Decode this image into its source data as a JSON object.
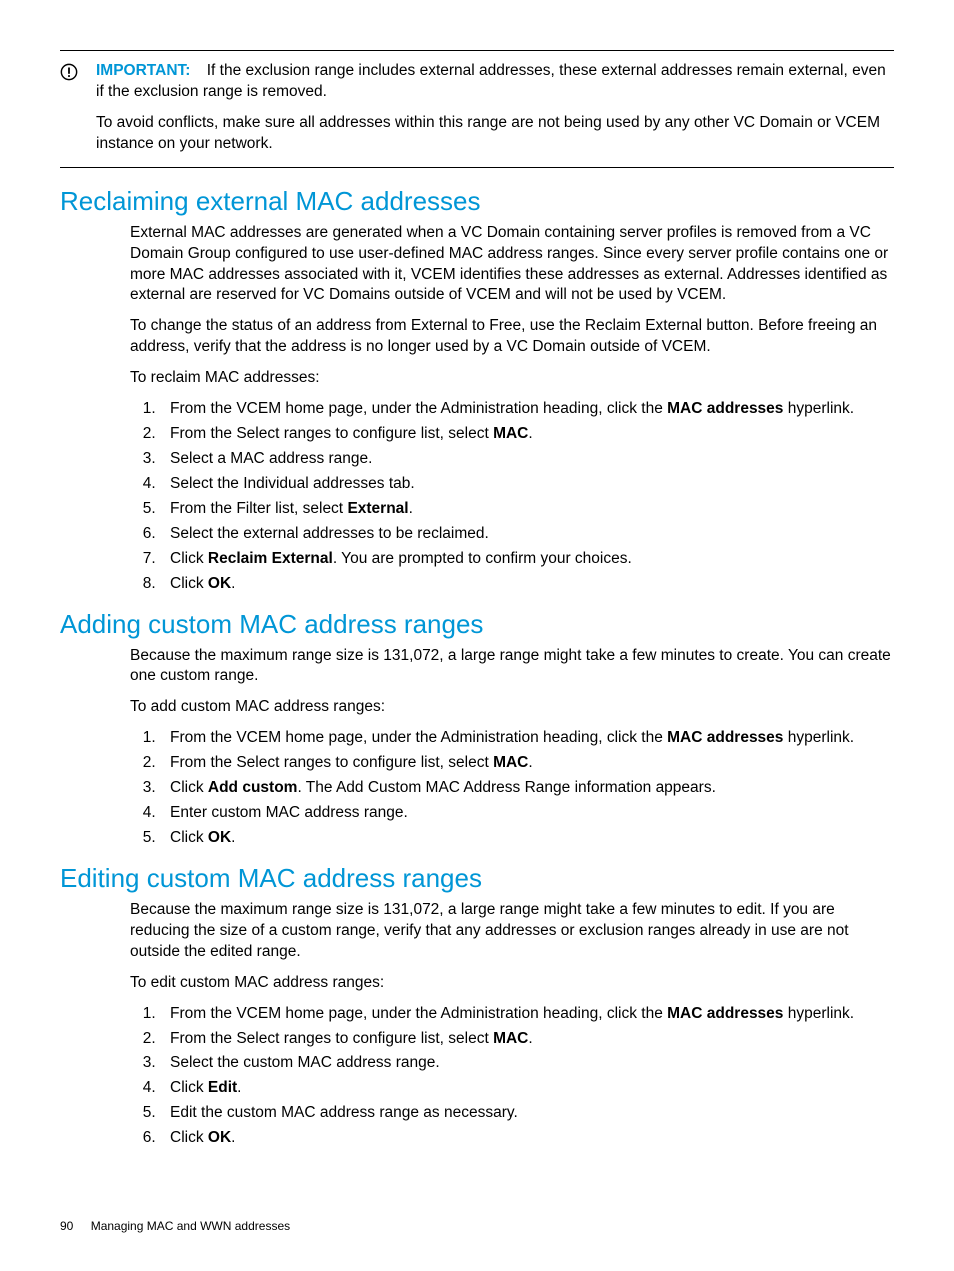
{
  "callout": {
    "label": "IMPORTANT:",
    "p1_a": "If the exclusion range includes external addresses, these external addresses remain external, even if the exclusion range is removed.",
    "p2": "To avoid conflicts, make sure all addresses within this range are not being used by any other VC Domain or VCEM instance on your network."
  },
  "s1": {
    "heading": "Reclaiming external MAC addresses",
    "p1": "External MAC addresses are generated when a VC Domain containing server profiles is removed from a VC Domain Group configured to use user-defined MAC address ranges. Since every server profile contains one or more MAC addresses associated with it, VCEM identifies these addresses as external. Addresses identified as external are reserved for VC Domains outside of VCEM and will not be used by VCEM.",
    "p2": "To change the status of an address from External to Free, use the Reclaim External button. Before freeing an address, verify that the address is no longer used by a VC Domain outside of VCEM.",
    "p3": "To reclaim MAC addresses:",
    "steps": {
      "s1a": "From the VCEM home page, under the Administration heading, click the ",
      "s1b": "MAC addresses",
      "s1c": " hyperlink.",
      "s2a": "From the Select ranges to configure list, select ",
      "s2b": "MAC",
      "s2c": ".",
      "s3": "Select a MAC address range.",
      "s4": "Select the Individual addresses tab.",
      "s5a": "From the Filter list, select ",
      "s5b": "External",
      "s5c": ".",
      "s6": "Select the external addresses to be reclaimed.",
      "s7a": "Click ",
      "s7b": "Reclaim External",
      "s7c": ". You are prompted to confirm your choices.",
      "s8a": "Click ",
      "s8b": "OK",
      "s8c": "."
    }
  },
  "s2": {
    "heading": "Adding custom MAC address ranges",
    "p1": "Because the maximum range size is 131,072, a large range might take a few minutes to create. You can create one custom range.",
    "p2": "To add custom MAC address ranges:",
    "steps": {
      "s1a": "From the VCEM home page, under the Administration heading, click the ",
      "s1b": "MAC addresses",
      "s1c": " hyperlink.",
      "s2a": "From the Select ranges to configure list, select ",
      "s2b": "MAC",
      "s2c": ".",
      "s3a": "Click ",
      "s3b": "Add custom",
      "s3c": ". The Add Custom MAC Address Range information appears.",
      "s4": "Enter custom MAC address range.",
      "s5a": "Click ",
      "s5b": "OK",
      "s5c": "."
    }
  },
  "s3": {
    "heading": "Editing custom MAC address ranges",
    "p1": "Because the maximum range size is 131,072, a large range might take a few minutes to edit. If you are reducing the size of a custom range, verify that any addresses or exclusion ranges already in use are not outside the edited range.",
    "p2": "To edit custom MAC address ranges:",
    "steps": {
      "s1a": "From the VCEM home page, under the Administration heading, click the ",
      "s1b": "MAC addresses",
      "s1c": " hyperlink.",
      "s2a": "From the Select ranges to configure list, select ",
      "s2b": "MAC",
      "s2c": ".",
      "s3": "Select the custom MAC address range.",
      "s4a": "Click ",
      "s4b": "Edit",
      "s4c": ".",
      "s5": "Edit the custom MAC address range as necessary.",
      "s6a": "Click ",
      "s6b": "OK",
      "s6c": "."
    }
  },
  "footer": {
    "page": "90",
    "chapter": "Managing MAC and WWN addresses"
  }
}
